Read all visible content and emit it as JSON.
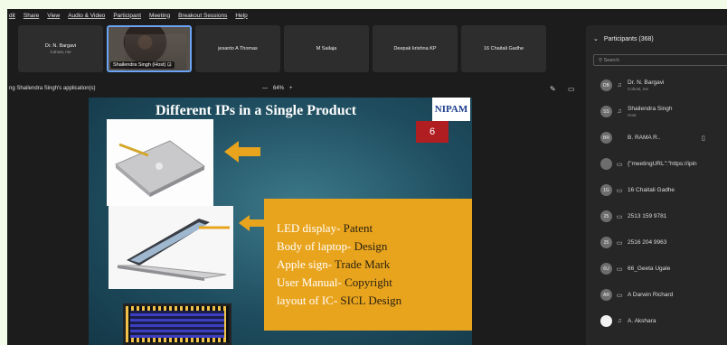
{
  "menu": [
    "dit",
    "Share",
    "View",
    "Audio & Video",
    "Participant",
    "Meeting",
    "Breakout Sessions",
    "Help"
  ],
  "tiles": [
    {
      "name": "Dr. N. Bargavi",
      "sub": "Cohost, me"
    },
    {
      "name": "Shailendra Singh (Host)",
      "icon": "screen-share-icon"
    },
    {
      "name": "jesanto A Thomas"
    },
    {
      "name": "M Sailaja"
    },
    {
      "name": "Deepak krishna KP"
    },
    {
      "name": "16 Chaitali Gadhe"
    }
  ],
  "share_label": "ng Shailendra Singh's application(s)",
  "zoom": {
    "minus": "—",
    "value": "64%",
    "plus": "+"
  },
  "slide": {
    "title": "Different IPs in a Single Product",
    "logo": "NIPAM",
    "number": "6",
    "items": [
      {
        "label": "LED display-",
        "value": " Patent"
      },
      {
        "label": "Body of laptop-",
        "value": " Design"
      },
      {
        "label": "Apple sign-",
        "value": " Trade Mark"
      },
      {
        "label": "User Manual-",
        "value": " Copyright"
      },
      {
        "label": "layout of IC-",
        "value": " SICL Design"
      }
    ]
  },
  "panel": {
    "title": "Participants (368)",
    "search_placeholder": "Search"
  },
  "participants": [
    {
      "initials": "DB",
      "name": "Dr. N. Bargavi",
      "sub": "Cohost, me"
    },
    {
      "initials": "SS",
      "name": "Shailendra Singh",
      "sub": "Host"
    },
    {
      "initials": "BR",
      "name": "B. RAMA R..",
      "extra": "▯"
    },
    {
      "initials": "",
      "name": "{\"meetingURL\":\"https://ipin"
    },
    {
      "initials": "1G",
      "name": "16 Chaitali Gadhe"
    },
    {
      "initials": "25",
      "name": "2513 159 9781"
    },
    {
      "initials": "25",
      "name": "2516 204 9963"
    },
    {
      "initials": "6U",
      "name": "66_Geeta Ugale"
    },
    {
      "initials": "AR",
      "name": "A Darwin Richard"
    },
    {
      "initials": "",
      "name": "A. Akshara"
    }
  ],
  "colors": {
    "accent": "#6ba3f5",
    "slide_box": "#e9a41e",
    "slide_num": "#b01e22"
  }
}
